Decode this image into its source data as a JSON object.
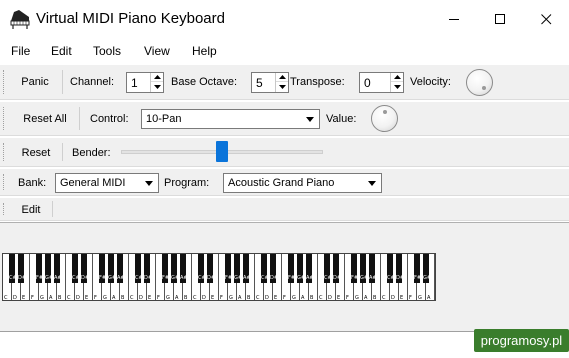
{
  "window": {
    "title": "Virtual MIDI Piano Keyboard"
  },
  "menu": {
    "items": [
      "File",
      "Edit",
      "Tools",
      "View",
      "Help"
    ]
  },
  "toolbar1": {
    "panic": "Panic",
    "channel_label": "Channel:",
    "channel_value": "1",
    "octave_label": "Base Octave:",
    "octave_value": "5",
    "transpose_label": "Transpose:",
    "transpose_value": "0",
    "velocity_label": "Velocity:"
  },
  "toolbar2": {
    "reset_all": "Reset All",
    "control_label": "Control:",
    "control_value": "10-Pan",
    "value_label": "Value:"
  },
  "toolbar3": {
    "reset": "Reset",
    "bender_label": "Bender:"
  },
  "toolbar4": {
    "bank_label": "Bank:",
    "bank_value": "General MIDI",
    "program_label": "Program:",
    "program_value": "Acoustic Grand Piano"
  },
  "toolbar5": {
    "edit": "Edit"
  },
  "keyboard": {
    "white_labels": [
      "C",
      "D",
      "E",
      "F",
      "G",
      "A",
      "B",
      "C",
      "D",
      "E",
      "F",
      "G",
      "A",
      "B",
      "C",
      "D",
      "E",
      "F",
      "G",
      "A",
      "B",
      "C",
      "D",
      "E",
      "F",
      "G",
      "A",
      "B",
      "C",
      "D",
      "E",
      "F",
      "G",
      "A",
      "B",
      "C",
      "D",
      "E",
      "F",
      "G",
      "A",
      "B",
      "C",
      "D",
      "E",
      "F",
      "G",
      "A"
    ],
    "black_labels": [
      "C#",
      "D#",
      "F#",
      "G#",
      "A#",
      "C#",
      "D#",
      "F#",
      "G#",
      "A#",
      "C#",
      "D#",
      "F#",
      "G#",
      "A#",
      "C#",
      "D#",
      "F#",
      "G#",
      "A#",
      "C#",
      "D#",
      "F#",
      "G#",
      "A#",
      "C#",
      "D#",
      "F#",
      "G#",
      "A#",
      "C#",
      "D#",
      "F#",
      "G#",
      "A#"
    ]
  },
  "watermark": "programosy.pl",
  "icons": {
    "app": "piano-icon",
    "minimize": "minimize-icon",
    "maximize": "maximize-icon",
    "close": "close-icon"
  },
  "colors": {
    "bender_thumb": "#0a74da",
    "watermark_bg": "#3a7d2c"
  }
}
